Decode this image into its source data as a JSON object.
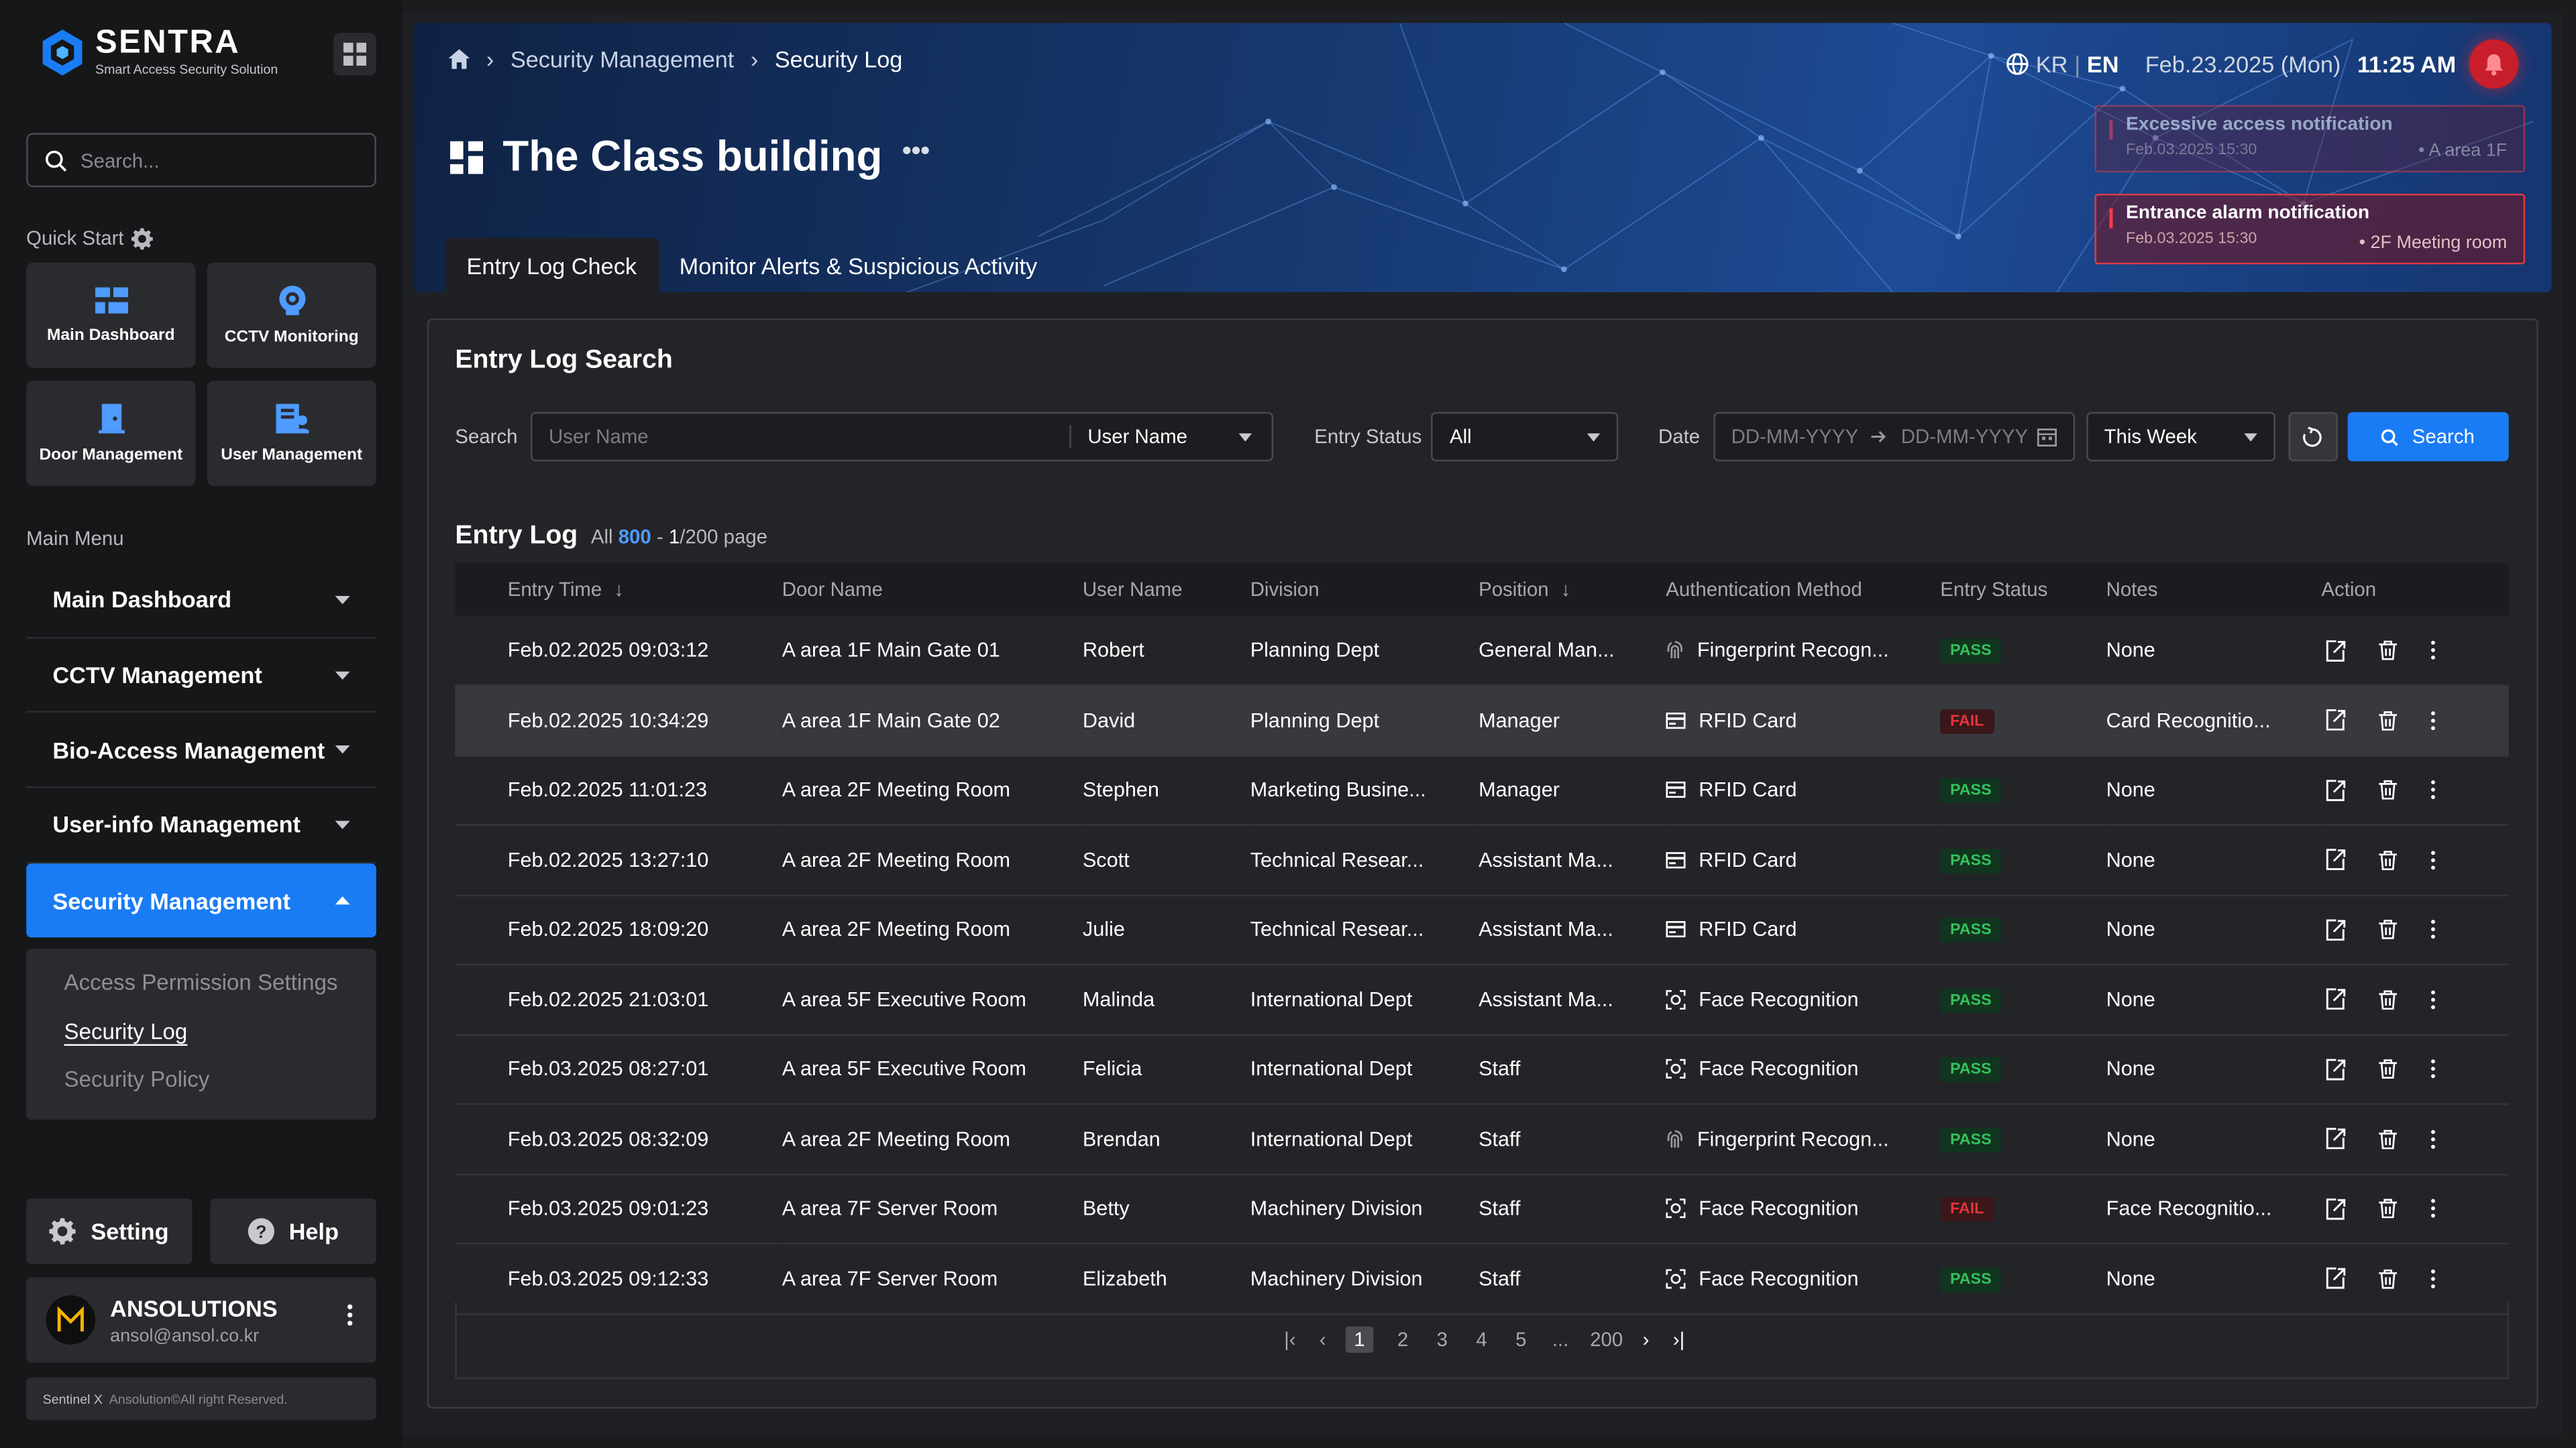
{
  "brand": {
    "name": "SENTRA",
    "tagline": "Smart Access Security Solution"
  },
  "sidebar": {
    "search_placeholder": "Search...",
    "quick_start_label": "Quick Start",
    "quick_start": [
      {
        "label": "Main Dashboard",
        "icon": "dashboard-icon"
      },
      {
        "label": "CCTV Monitoring",
        "icon": "cctv-icon"
      },
      {
        "label": "Door Management",
        "icon": "door-icon"
      },
      {
        "label": "User Management",
        "icon": "user-management-icon"
      }
    ],
    "main_menu_label": "Main Menu",
    "menu": [
      {
        "label": "Main Dashboard"
      },
      {
        "label": "CCTV Management"
      },
      {
        "label": "Bio-Access Management"
      },
      {
        "label": "User-info Management"
      },
      {
        "label": "Security Management"
      }
    ],
    "submenu": [
      "Access Permission Settings",
      "Security Log",
      "Security Policy"
    ],
    "setting_label": "Setting",
    "help_label": "Help",
    "user": {
      "name": "ANSOLUTIONS",
      "email": "ansol@ansol.co.kr"
    },
    "copyright": {
      "brand": "Sentinel X",
      "text": "Ansolution©All right Reserved."
    }
  },
  "header": {
    "breadcrumb": [
      "Security Management",
      "Security Log"
    ],
    "lang_kr": "KR",
    "lang_en": "EN",
    "date": "Feb.23.2025 (Mon)",
    "time": "11:25 AM",
    "title": "The Class building",
    "tabs": [
      "Entry Log Check",
      "Monitor Alerts & Suspicious Activity"
    ],
    "notifications": [
      {
        "title": "Excessive access notification",
        "date": "Feb.03.2025 15:30",
        "location": "• A area 1F"
      },
      {
        "title": "Entrance alarm notification",
        "date": "Feb.03.2025 15:30",
        "location": "• 2F Meeting room"
      }
    ]
  },
  "search_panel": {
    "title": "Entry Log Search",
    "search_label": "Search",
    "search_placeholder": "User Name",
    "search_field_select": "User Name",
    "entry_status_label": "Entry Status",
    "entry_status_value": "All",
    "date_label": "Date",
    "date_from_placeholder": "DD-MM-YYYY",
    "date_to_placeholder": "DD-MM-YYYY",
    "period_value": "This Week",
    "search_button": "Search"
  },
  "entry_log": {
    "title": "Entry Log",
    "all_label": "All",
    "total": "800",
    "page_current": "1",
    "page_suffix": "/200 page",
    "columns": [
      "Entry Time",
      "Door Name",
      "User Name",
      "Division",
      "Position",
      "Authentication Method",
      "Entry Status",
      "Notes",
      "Action"
    ],
    "rows": [
      {
        "time": "Feb.02.2025 09:03:12",
        "door": "A area 1F Main Gate 01",
        "user": "Robert",
        "division": "Planning Dept",
        "position": "General Man...",
        "auth": "Fingerprint Recogn...",
        "auth_icon": "fingerprint-icon",
        "status": "PASS",
        "notes": "None"
      },
      {
        "time": "Feb.02.2025 10:34:29",
        "door": "A area 1F Main Gate 02",
        "user": "David",
        "division": "Planning Dept",
        "position": "Manager",
        "auth": "RFID Card",
        "auth_icon": "card-icon",
        "status": "FAIL",
        "notes": "Card Recognitio..."
      },
      {
        "time": "Feb.02.2025 11:01:23",
        "door": "A area 2F Meeting Room",
        "user": "Stephen",
        "division": "Marketing Busine...",
        "position": "Manager",
        "auth": "RFID Card",
        "auth_icon": "card-icon",
        "status": "PASS",
        "notes": "None"
      },
      {
        "time": "Feb.02.2025 13:27:10",
        "door": "A area 2F Meeting Room",
        "user": "Scott",
        "division": "Technical Resear...",
        "position": "Assistant Ma...",
        "auth": "RFID Card",
        "auth_icon": "card-icon",
        "status": "PASS",
        "notes": "None"
      },
      {
        "time": "Feb.02.2025 18:09:20",
        "door": "A area 2F Meeting Room",
        "user": "Julie",
        "division": "Technical Resear...",
        "position": "Assistant Ma...",
        "auth": "RFID Card",
        "auth_icon": "card-icon",
        "status": "PASS",
        "notes": "None"
      },
      {
        "time": "Feb.02.2025 21:03:01",
        "door": "A area 5F Executive Room",
        "user": "Malinda",
        "division": "International Dept",
        "position": "Assistant Ma...",
        "auth": "Face Recognition",
        "auth_icon": "face-icon",
        "status": "PASS",
        "notes": "None"
      },
      {
        "time": "Feb.03.2025 08:27:01",
        "door": "A area 5F Executive Room",
        "user": "Felicia",
        "division": "International Dept",
        "position": "Staff",
        "auth": "Face Recognition",
        "auth_icon": "face-icon",
        "status": "PASS",
        "notes": "None"
      },
      {
        "time": "Feb.03.2025 08:32:09",
        "door": "A area 2F Meeting Room",
        "user": "Brendan",
        "division": "International Dept",
        "position": "Staff",
        "auth": "Fingerprint Recogn...",
        "auth_icon": "fingerprint-icon",
        "status": "PASS",
        "notes": "None"
      },
      {
        "time": "Feb.03.2025 09:01:23",
        "door": "A area 7F Server Room",
        "user": "Betty",
        "division": "Machinery Division",
        "position": "Staff",
        "auth": "Face Recognition",
        "auth_icon": "face-icon",
        "status": "FAIL",
        "notes": "Face Recognitio..."
      },
      {
        "time": "Feb.03.2025 09:12:33",
        "door": "A area 7F Server Room",
        "user": "Elizabeth",
        "division": "Machinery Division",
        "position": "Staff",
        "auth": "Face Recognition",
        "auth_icon": "face-icon",
        "status": "PASS",
        "notes": "None"
      }
    ],
    "pagination": [
      "1",
      "2",
      "3",
      "4",
      "5",
      "...",
      "200"
    ]
  },
  "colors": {
    "accent": "#1a7cf5",
    "pass": "#34c25c",
    "fail": "#e2343d",
    "alert": "#c81e2b"
  }
}
